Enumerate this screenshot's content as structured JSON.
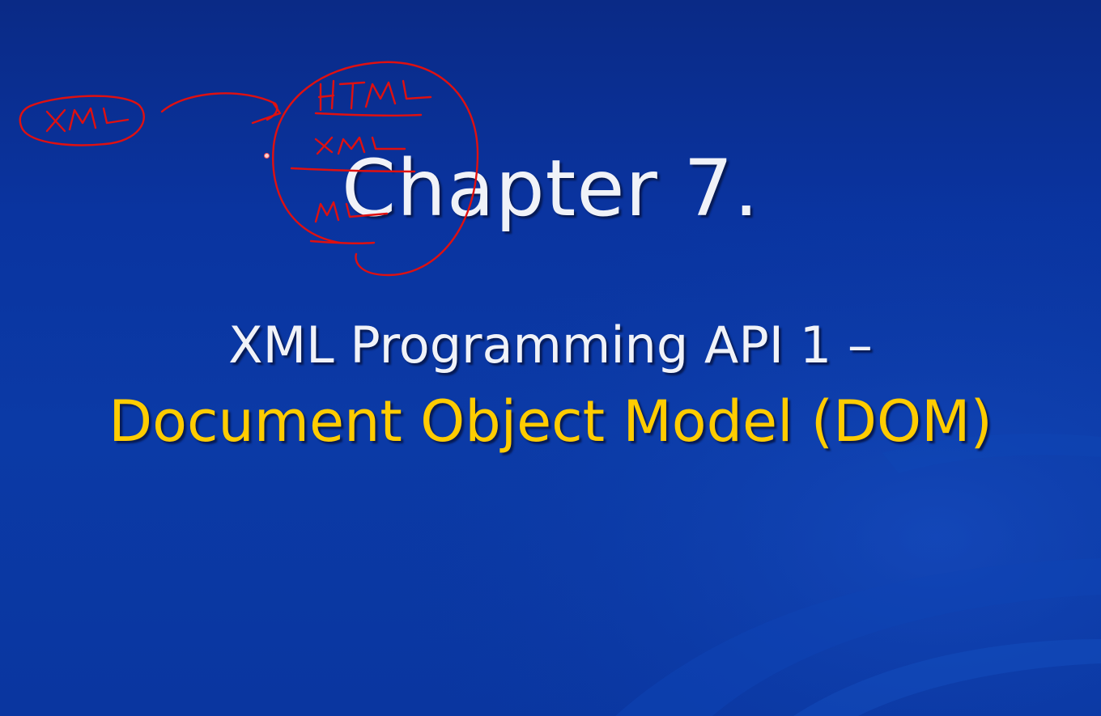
{
  "slide": {
    "title": "Chapter 7.",
    "subtitle_line1": "XML Programming API 1 –",
    "subtitle_line2": "Document Object Model (DOM)"
  },
  "colors": {
    "background": "#0b3aa6",
    "title_text": "#f0f2f8",
    "subtitle_highlight": "#ffcc00",
    "annotation_ink": "#e01010"
  },
  "annotations": {
    "handwritten_left": "XML",
    "handwritten_list": [
      "HTML",
      "XML",
      "ML"
    ]
  }
}
